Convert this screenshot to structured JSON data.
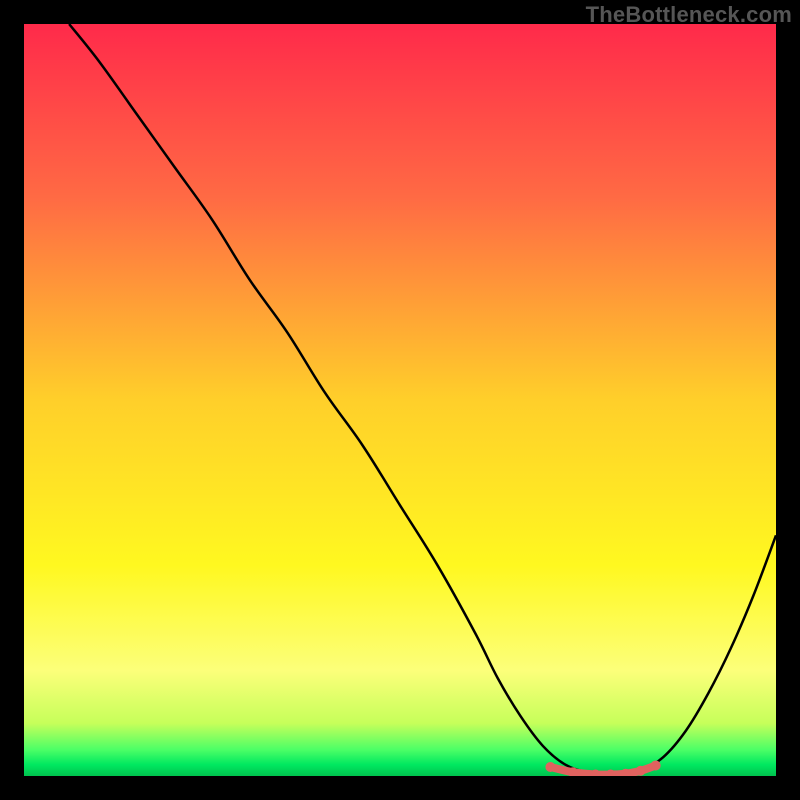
{
  "watermark": "TheBottleneck.com",
  "chart_data": {
    "type": "line",
    "title": "",
    "xlabel": "",
    "ylabel": "",
    "xlim": [
      0,
      100
    ],
    "ylim": [
      0,
      100
    ],
    "curve": {
      "name": "bottleneck",
      "x": [
        6,
        10,
        15,
        20,
        25,
        30,
        35,
        40,
        45,
        50,
        55,
        60,
        63,
        66,
        69,
        72,
        75,
        78,
        80,
        82,
        85,
        88,
        91,
        94,
        97,
        100
      ],
      "y": [
        100,
        95,
        88,
        81,
        74,
        66,
        59,
        51,
        44,
        36,
        28,
        19,
        13,
        8,
        4,
        1.5,
        0.5,
        0.2,
        0.2,
        0.7,
        2.5,
        6,
        11,
        17,
        24,
        32
      ]
    },
    "valley_highlight": {
      "x": [
        70,
        73,
        76,
        78,
        80,
        82,
        84
      ],
      "y": [
        1.2,
        0.5,
        0.2,
        0.2,
        0.3,
        0.7,
        1.4
      ]
    },
    "gradient_stops": [
      {
        "offset": 0,
        "color": "#ff2a4a"
      },
      {
        "offset": 0.23,
        "color": "#ff6a44"
      },
      {
        "offset": 0.5,
        "color": "#ffcf2a"
      },
      {
        "offset": 0.72,
        "color": "#fff820"
      },
      {
        "offset": 0.86,
        "color": "#fcff7a"
      },
      {
        "offset": 0.93,
        "color": "#c6ff5a"
      },
      {
        "offset": 0.965,
        "color": "#4cff66"
      },
      {
        "offset": 0.985,
        "color": "#00e860"
      },
      {
        "offset": 1.0,
        "color": "#00c24e"
      }
    ]
  }
}
